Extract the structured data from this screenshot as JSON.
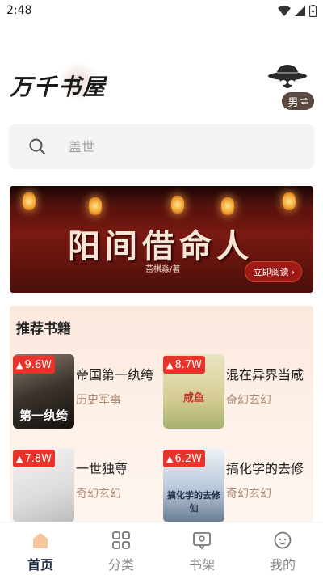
{
  "status_bar": {
    "time": "2:48"
  },
  "header": {
    "logo": "万千书屋",
    "gender_label": "男"
  },
  "search": {
    "placeholder": "盖世"
  },
  "banner": {
    "title": "阳间借命人",
    "author": "苗棋淼/著",
    "read_button": "立即阅读"
  },
  "recommend": {
    "title": "推荐书籍",
    "books": [
      {
        "name": "帝国第一纨绔",
        "tag": "历史军事",
        "reads": "9.6W",
        "cover_text": "第一纨绔"
      },
      {
        "name": "混在异界当咸",
        "tag": "奇幻玄幻",
        "reads": "8.7W",
        "cover_text": "咸鱼"
      },
      {
        "name": "一世独尊",
        "tag": "奇幻玄幻",
        "reads": "7.8W",
        "cover_text": ""
      },
      {
        "name": "搞化学的去修",
        "tag": "奇幻玄幻",
        "reads": "6.2W",
        "cover_text": "搞化学的去修仙"
      }
    ]
  },
  "tabbar": {
    "tabs": [
      {
        "label": "首页",
        "icon": "home-icon",
        "active": true
      },
      {
        "label": "分类",
        "icon": "category-icon",
        "active": false
      },
      {
        "label": "书架",
        "icon": "bookshelf-icon",
        "active": false
      },
      {
        "label": "我的",
        "icon": "profile-icon",
        "active": false
      }
    ]
  },
  "colors": {
    "accent": "#e8332a",
    "tab_active": "#1f2a44",
    "home_icon": "#f5c69b",
    "panel": "#fbe8dd"
  }
}
